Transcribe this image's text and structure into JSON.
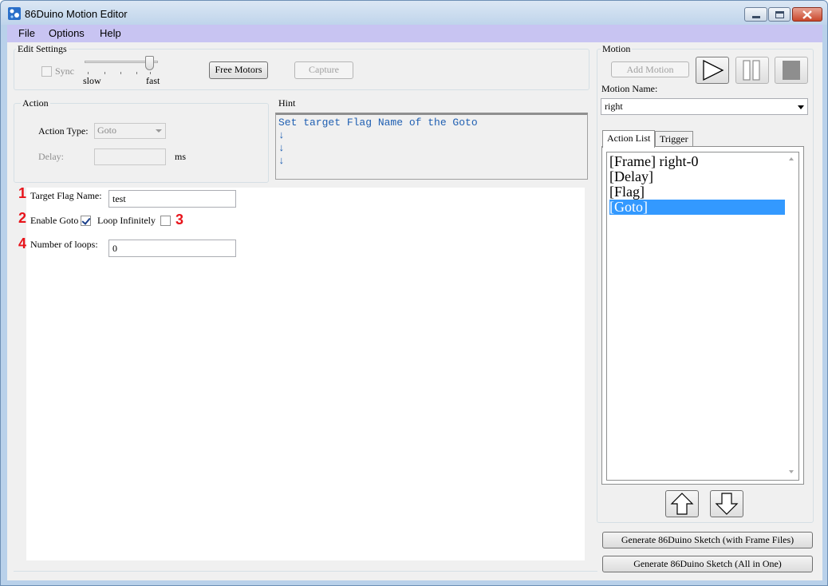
{
  "window": {
    "title": "86Duino Motion Editor"
  },
  "menu": [
    "File",
    "Options",
    "Help"
  ],
  "edit_settings": {
    "label": "Edit Settings",
    "sync_label": "Sync",
    "slider_slow": "slow",
    "slider_fast": "fast",
    "free_motors": "Free Motors",
    "capture": "Capture"
  },
  "action": {
    "label": "Action",
    "type_label": "Action Type:",
    "type_value": "Goto",
    "delay_label": "Delay:",
    "delay_unit": "ms"
  },
  "hint": {
    "label": "Hint",
    "lines": [
      "Set target Flag Name of the Goto",
      "↓",
      "↓",
      "↓"
    ]
  },
  "goto_form": {
    "badges": [
      "1",
      "2",
      "3",
      "4"
    ],
    "flag_name_label": "Target Flag Name:",
    "flag_name_value": "test",
    "enable_goto_label": "Enable Goto",
    "enable_goto_checked": true,
    "loop_infinitely_label": "Loop Infinitely",
    "loop_infinitely_checked": false,
    "loops_label": "Number of loops:",
    "loops_value": "0"
  },
  "motion": {
    "label": "Motion",
    "add_motion": "Add Motion",
    "name_label": "Motion Name:",
    "name_value": "right",
    "tabs": [
      "Action List",
      "Trigger"
    ],
    "actions": [
      "[Frame] right-0",
      "[Delay]",
      "[Flag]",
      "[Goto]"
    ],
    "selected_action_index": 3
  },
  "generate": {
    "with_frames": "Generate 86Duino Sketch (with Frame Files)",
    "all_in_one": "Generate 86Duino Sketch (All in One)"
  },
  "colors": {
    "menubar": "#c8c4f2",
    "hint_text": "#1f5fb2",
    "badge": "#e8141b",
    "selection": "#3399ff"
  }
}
